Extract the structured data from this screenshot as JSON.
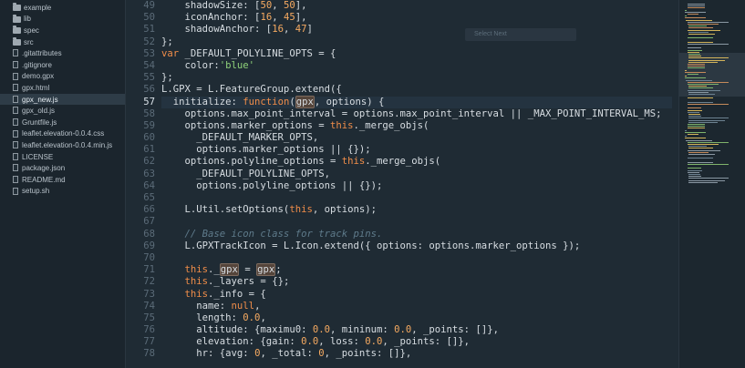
{
  "sidebar": {
    "items": [
      {
        "label": "example",
        "type": "folder"
      },
      {
        "label": "lib",
        "type": "folder"
      },
      {
        "label": "spec",
        "type": "folder"
      },
      {
        "label": "src",
        "type": "folder"
      },
      {
        "label": ".gitattributes",
        "type": "file"
      },
      {
        "label": ".gitignore",
        "type": "file"
      },
      {
        "label": "demo.gpx",
        "type": "file"
      },
      {
        "label": "gpx.html",
        "type": "file"
      },
      {
        "label": "gpx_new.js",
        "type": "file",
        "selected": true
      },
      {
        "label": "gpx_old.js",
        "type": "file"
      },
      {
        "label": "Gruntfile.js",
        "type": "file"
      },
      {
        "label": "leaflet.elevation-0.0.4.css",
        "type": "file"
      },
      {
        "label": "leaflet.elevation-0.0.4.min.js",
        "type": "file"
      },
      {
        "label": "LICENSE",
        "type": "file"
      },
      {
        "label": "package.json",
        "type": "file"
      },
      {
        "label": "README.md",
        "type": "file"
      },
      {
        "label": "setup.sh",
        "type": "file"
      }
    ]
  },
  "find_box": {
    "label": "Select Next"
  },
  "editor": {
    "active_line": 57,
    "lines": [
      {
        "n": "49",
        "c": "    shadowSize: [50, 50],"
      },
      {
        "n": "50",
        "c": "    iconAnchor: [16, 45],"
      },
      {
        "n": "51",
        "c": "    shadowAnchor: [16, 47]"
      },
      {
        "n": "52",
        "c": "};"
      },
      {
        "n": "53",
        "c": "var _DEFAULT_POLYLINE_OPTS = {"
      },
      {
        "n": "54",
        "c": "    color:'blue'"
      },
      {
        "n": "55",
        "c": "};"
      },
      {
        "n": "56",
        "c": "L.GPX = L.FeatureGroup.extend({"
      },
      {
        "n": "57",
        "c": "  initialize: function(gpx, options) {"
      },
      {
        "n": "58",
        "c": "    options.max_point_interval = options.max_point_interval || _MAX_POINT_INTERVAL_MS;"
      },
      {
        "n": "59",
        "c": "    options.marker_options = this._merge_objs("
      },
      {
        "n": "60",
        "c": "      _DEFAULT_MARKER_OPTS,"
      },
      {
        "n": "61",
        "c": "      options.marker_options || {});"
      },
      {
        "n": "62",
        "c": "    options.polyline_options = this._merge_objs("
      },
      {
        "n": "63",
        "c": "      _DEFAULT_POLYLINE_OPTS,"
      },
      {
        "n": "64",
        "c": "      options.polyline_options || {});"
      },
      {
        "n": "65",
        "c": ""
      },
      {
        "n": "66",
        "c": "    L.Util.setOptions(this, options);"
      },
      {
        "n": "67",
        "c": ""
      },
      {
        "n": "68",
        "c": "    // Base icon class for track pins."
      },
      {
        "n": "69",
        "c": "    L.GPXTrackIcon = L.Icon.extend({ options: options.marker_options });"
      },
      {
        "n": "70",
        "c": ""
      },
      {
        "n": "71",
        "c": "    this._gpx = gpx;"
      },
      {
        "n": "72",
        "c": "    this._layers = {};"
      },
      {
        "n": "73",
        "c": "    this._info = {"
      },
      {
        "n": "74",
        "c": "      name: null,"
      },
      {
        "n": "75",
        "c": "      length: 0.0,"
      },
      {
        "n": "76",
        "c": "      altitude: {maximu0: 0.0, mininum: 0.0, _points: []},"
      },
      {
        "n": "77",
        "c": "      elevation: {gain: 0.0, loss: 0.0, _points: []},"
      },
      {
        "n": "78",
        "c": "      hr: {avg: 0, _total: 0, _points: []},"
      }
    ]
  }
}
